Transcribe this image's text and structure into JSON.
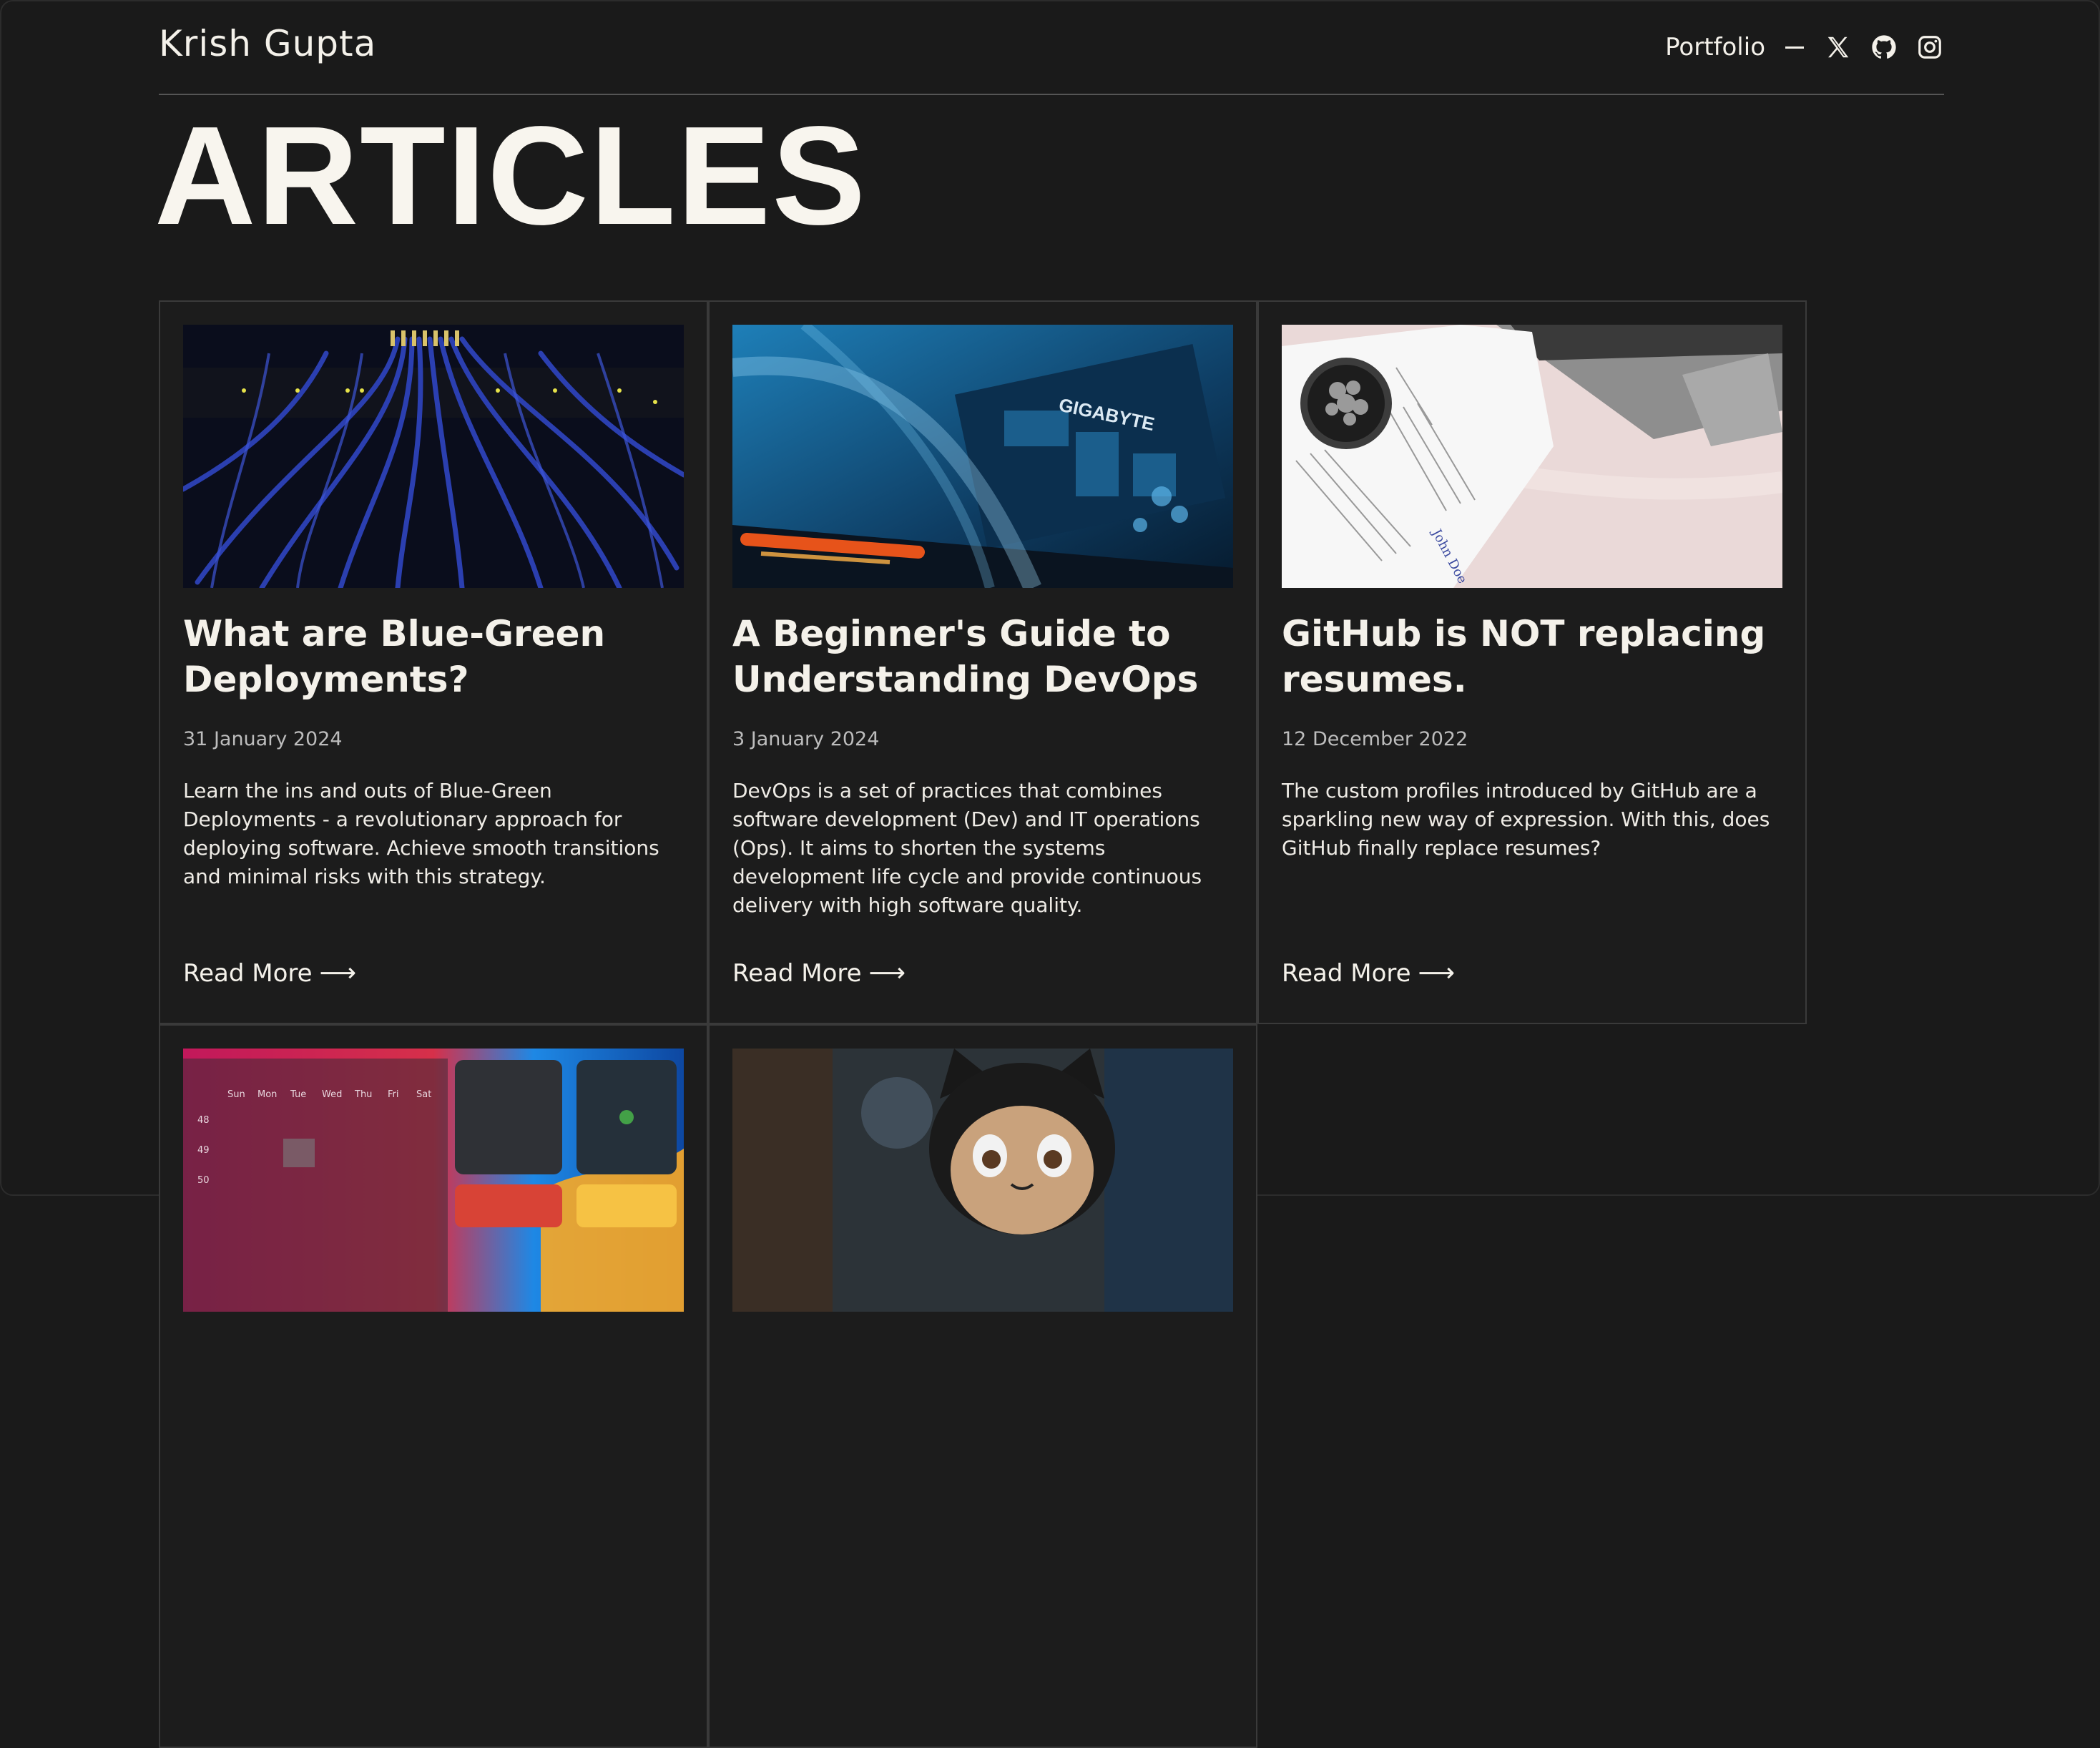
{
  "header": {
    "brand": "Krish Gupta",
    "nav_link": "Portfolio",
    "icons": [
      "x-icon",
      "github-icon",
      "instagram-icon"
    ]
  },
  "page_title": "ARTICLES",
  "articles": [
    {
      "title": "What are Blue-Green Deployments?",
      "date": "31 January 2024",
      "description": "Learn the ins and outs of Blue-Green Deployments - a revolutionary approach for deploying software. Achieve smooth transitions and minimal risks with this strategy.",
      "read_more": "Read More",
      "image": "server-cables-image"
    },
    {
      "title": "A Beginner's Guide to Understanding DevOps",
      "date": "3 January 2024",
      "description": "DevOps is a set of practices that combines software development (Dev) and IT operations (Ops). It aims to shorten the systems development life cycle and provide continuous delivery with high software quality.",
      "read_more": "Read More",
      "image": "motherboard-image",
      "image_label": "GIGABYTE"
    },
    {
      "title": "GitHub is NOT replacing resumes.",
      "date": "12 December 2022",
      "description": "The custom profiles introduced by GitHub are a sparkling new way of expression. With this, does GitHub finally replace resumes?",
      "read_more": "Read More",
      "image": "resume-laptop-image",
      "image_label": "John Doe"
    },
    {
      "image": "calendar-ui-image",
      "calendar_days": [
        "Sun",
        "Mon",
        "Tue",
        "Wed",
        "Thu",
        "Fri",
        "Sat"
      ],
      "calendar_weeks": [
        "48",
        "49",
        "50"
      ]
    },
    {
      "image": "octocat-figure-image"
    }
  ],
  "colors": {
    "background": "#1a1a1a",
    "text": "#f4f1ea",
    "muted": "#bdbdbd",
    "border": "#3a3a3a"
  }
}
